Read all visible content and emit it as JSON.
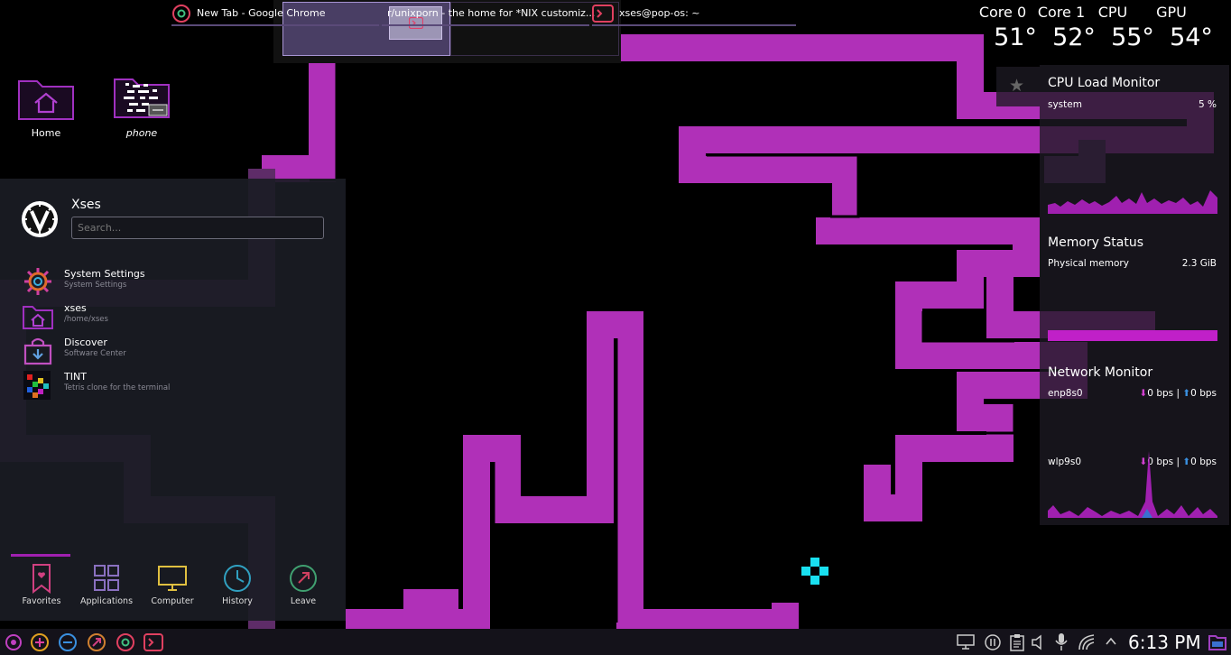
{
  "colors": {
    "maze_path": "#b030b8",
    "maze_path_dim": "#5e2c68",
    "accent_cyan": "#19e0f0",
    "taskbar_bg": "#14121a",
    "launcher_bg": "#1a1c24"
  },
  "pager": {
    "active_window_icon": "terminal-icon"
  },
  "desktop_icons": [
    {
      "label": "Home",
      "icon": "home-folder-icon"
    },
    {
      "label": "phone",
      "icon": "phone-folder-icon"
    }
  ],
  "sensors": [
    {
      "label": "Core 0",
      "value": "51°"
    },
    {
      "label": "Core 1",
      "value": "52°"
    },
    {
      "label": "CPU",
      "value": "55°"
    },
    {
      "label": "GPU",
      "value": "54°"
    }
  ],
  "cpu_monitor": {
    "title": "CPU Load Monitor",
    "row_label": "system",
    "row_value": "5 %"
  },
  "memory_monitor": {
    "title": "Memory Status",
    "row_label": "Physical memory",
    "row_value": "2.3 GiB"
  },
  "network_monitor": {
    "title": "Network Monitor",
    "interfaces": [
      {
        "name": "enp8s0",
        "down": "0 bps",
        "sep": "|",
        "up": "0 bps"
      },
      {
        "name": "wlp9s0",
        "down": "0 bps",
        "sep": "|",
        "up": "0 bps"
      }
    ]
  },
  "launcher": {
    "user": "Xses",
    "search_placeholder": "Search...",
    "apps": [
      {
        "name": "System Settings",
        "desc": "System Settings",
        "icon": "settings-gear-icon"
      },
      {
        "name": "xses",
        "desc": "/home/xses",
        "icon": "home-folder-icon"
      },
      {
        "name": "Discover",
        "desc": "Software Center",
        "icon": "discover-icon"
      },
      {
        "name": "TINT",
        "desc": "Tetris clone for the terminal",
        "icon": "tetris-icon"
      }
    ],
    "bottom_tabs": [
      {
        "label": "Favorites",
        "icon": "bookmark-heart-icon"
      },
      {
        "label": "Applications",
        "icon": "grid-icon"
      },
      {
        "label": "Computer",
        "icon": "monitor-icon"
      },
      {
        "label": "History",
        "icon": "clock-icon"
      },
      {
        "label": "Leave",
        "icon": "leave-icon"
      }
    ]
  },
  "taskbar": {
    "tasks": [
      {
        "title": "New Tab - Google Chrome",
        "icon": "chrome-icon"
      },
      {
        "title": "r/unixporn - the home for *NIX customiz...",
        "icon": "chrome-icon"
      },
      {
        "title": "xses@pop-os: ~",
        "icon": "terminal-icon"
      }
    ],
    "clock": "6:13 PM"
  }
}
